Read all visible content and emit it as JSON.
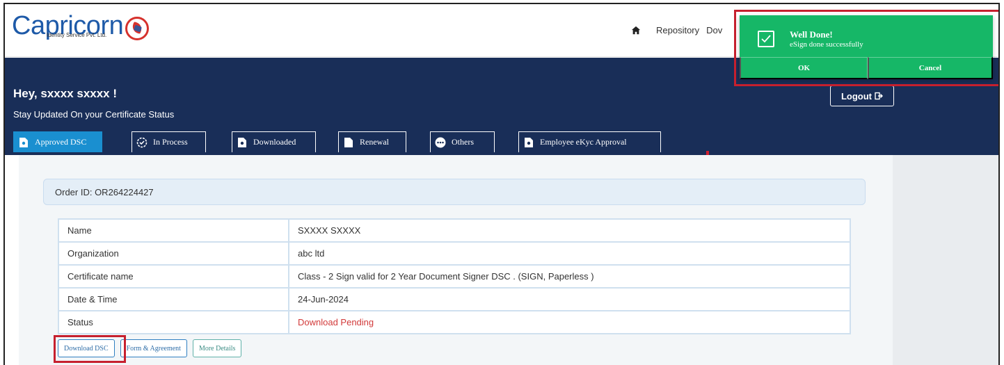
{
  "brand": {
    "name": "Capricorn",
    "tagline": "Identity Service Pvt. Ltd.",
    "word_color": "#1e5aa8",
    "mark_color": "#d6322d"
  },
  "nav": {
    "home_icon": "home-icon",
    "links": [
      "Repository",
      "Dov"
    ]
  },
  "header": {
    "greeting": "Hey, sxxxx  sxxxx !",
    "subtitle": "Stay Updated On your Certificate Status",
    "logout_label": "Logout",
    "logout_icon": "sign-out-icon",
    "background": "#192e58"
  },
  "tabs": [
    {
      "label": "Approved DSC",
      "icon": "document-icon",
      "active": true
    },
    {
      "label": "In Process",
      "icon": "clock-icon",
      "active": false
    },
    {
      "label": "Downloaded",
      "icon": "document-icon",
      "active": false
    },
    {
      "label": "Renewal",
      "icon": "file-icon",
      "active": false
    },
    {
      "label": "Others",
      "icon": "ellipsis-icon",
      "active": false
    },
    {
      "label": "Employee eKyc Approval",
      "icon": "document-icon",
      "active": false
    }
  ],
  "order": {
    "id_label": "Order ID: OR264224427",
    "rows": [
      {
        "key": "Name",
        "value": "SXXXX SXXXX"
      },
      {
        "key": "Organization",
        "value": "abc ltd"
      },
      {
        "key": "Certificate name",
        "value": "Class - 2 Sign valid for 2 Year Document Signer DSC . (SIGN, Paperless )"
      },
      {
        "key": "Date & Time",
        "value": "24-Jun-2024"
      },
      {
        "key": "Status",
        "value": "Download Pending"
      }
    ],
    "status_color": "#d23a3a"
  },
  "actions": {
    "download": "Download DSC",
    "form": "Form & Agreement",
    "more": "More Details"
  },
  "toast": {
    "title": "Well Done!",
    "message": "eSign done successfully",
    "ok_label": "OK",
    "cancel_label": "Cancel",
    "icon": "check-icon",
    "color": "#16b767"
  },
  "highlight_color": "#c6202e"
}
